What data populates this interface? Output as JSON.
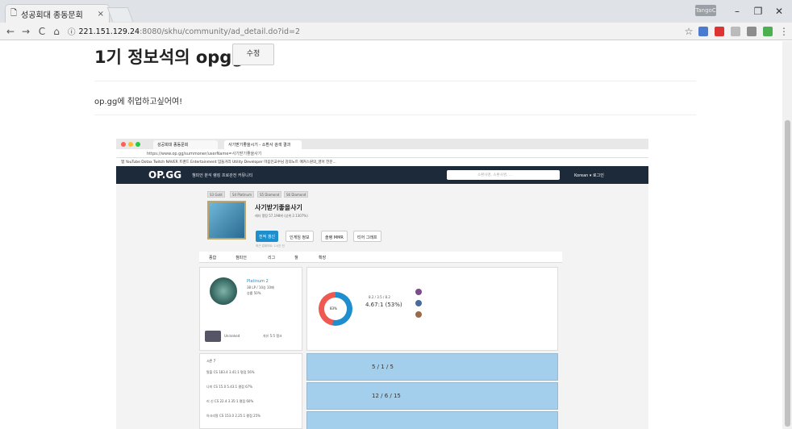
{
  "browser": {
    "tab_title": "성공회대 종동문회",
    "tab_close": "×",
    "url_host": "221.151.129.24",
    "url_path": ":8080/skhu/community/ad_detail.do?id=2",
    "window_user": "TangoC",
    "minimize": "–",
    "maximize": "❐",
    "close": "✕"
  },
  "post": {
    "title": "1기 정보석의 opgg",
    "edit_label": "수정",
    "body": "op.gg에 취업하고싶어여!"
  },
  "shot": {
    "tab1": "성공회대 종동문회",
    "tab2": "사기받기좋을시기 - 소환사 검색 결과",
    "address": "https://www.op.gg/summoner/userName=사기받기좋을사기",
    "bookmarks": "앱  YouTube  Dotax  Twitch  NAVER  트랜드  Entertainment  밈들거리  Utility  Developer  마음인교수님 강의노트  애커스원의_영어 전문...",
    "logo": "OP.GG",
    "menu": "챔피언 분석   랭킹   프로관전   커뮤니티",
    "search_placeholder": "소환사명, 소환사명, ...",
    "lang": "Korean ▾   로그인",
    "seasons": [
      "S3 Gold",
      "S4 Platinum",
      "S5 Diamond",
      "S6 Diamond"
    ],
    "summoner_name": "사기받기좋을사기",
    "ladder": "래더 랭킹 57,198위 (상위 2.1307%)",
    "btn_update": "전적 갱신",
    "btn_ingame": "인게임 정보",
    "btn_mmr": "솔랭 MMR",
    "btn_graph": "티어 그래프",
    "updated": "최근 업데이트: 1시간 전",
    "tabs": [
      "종합",
      "챔피언",
      "리그",
      "챌",
      "확장"
    ],
    "tier": "Platinum 2",
    "lp": "38 LP / 10승 10패",
    "winrate": "승률 50%",
    "unranked": "Unranked",
    "flex": "자유 5:5 랭크",
    "summary_wl": "8.2 / 3.5 / 8.2",
    "summary_kda": "4.67:1 (53%)",
    "donut_label": "83%",
    "season_tab": "시즌 7",
    "champ_rows": [
      "탈볼  CS 183.4  3.41:1 평점  56%",
      "나미  CS 15.0  5.43:1 평점  67%",
      "리 신  CS 22.4  3.35:1 평점  60%",
      "아크리알  CS 153.0  2.25:1 평점  25%"
    ],
    "match1_kda": "5 / 1 / 5",
    "match2_kda": "12 / 6 / 15"
  },
  "colors": {
    "opgg_nav": "#1d2a3a",
    "win_blue": "#a3cfec",
    "loss_red": "#e2b6b3",
    "accent": "#1f8ecd"
  }
}
